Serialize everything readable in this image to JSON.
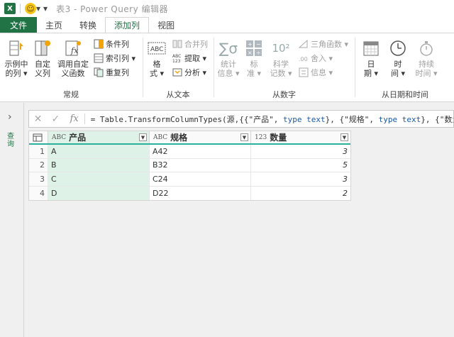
{
  "title": "表3 - Power Query 编辑器",
  "tabs": [
    "文件",
    "主页",
    "转换",
    "添加列",
    "视图"
  ],
  "ribbon": {
    "groups": {
      "general": "常规",
      "from_text": "从文本",
      "from_number": "从数字",
      "from_datetime": "从日期和时间"
    },
    "example_col": [
      "示例中",
      "的列 ▾"
    ],
    "custom_col": [
      "自定",
      "义列"
    ],
    "invoke_fn": [
      "调用自定",
      "义函数"
    ],
    "conditional": "条件列",
    "index": "索引列 ▾",
    "duplicate": "重复列",
    "format": [
      "格",
      "式 ▾"
    ],
    "merge": "合并列",
    "extract": "提取 ▾",
    "parse": "分析 ▾",
    "stats": [
      "统计",
      "信息 ▾"
    ],
    "standard": [
      "标",
      "准 ▾"
    ],
    "scientific": [
      "科学",
      "记数 ▾"
    ],
    "trig": "三角函数 ▾",
    "rounding": "舍入 ▾",
    "info": "信息 ▾",
    "date": [
      "日",
      "期 ▾"
    ],
    "time": [
      "时",
      "间 ▾"
    ],
    "duration": [
      "持续",
      "时间 ▾"
    ]
  },
  "sidebar": {
    "label": "查询"
  },
  "formula": {
    "prefix": "= Table.TransformColumnTypes(源,{{\"产品\", ",
    "kw1": "type text",
    "mid1": "}, {\"规格\", ",
    "kw2": "type text",
    "mid2": "}, {\"数量\",",
    "cancel": "✕",
    "confirm": "✓",
    "fx": "fx"
  },
  "table": {
    "columns": [
      {
        "name": "产品",
        "type_icon": "ABC"
      },
      {
        "name": "规格",
        "type_icon": "ABC"
      },
      {
        "name": "数量",
        "type_icon": "123"
      }
    ],
    "rows": [
      {
        "num": "1",
        "product": "A",
        "spec": "A42",
        "qty": "3"
      },
      {
        "num": "2",
        "product": "B",
        "spec": "B32",
        "qty": "5"
      },
      {
        "num": "3",
        "product": "C",
        "spec": "C24",
        "qty": "3"
      },
      {
        "num": "4",
        "product": "D",
        "spec": "D22",
        "qty": "2"
      }
    ]
  },
  "colors": {
    "accent": "#217346",
    "header_line": "#2bb09b",
    "selected_col": "#dff2e8"
  }
}
